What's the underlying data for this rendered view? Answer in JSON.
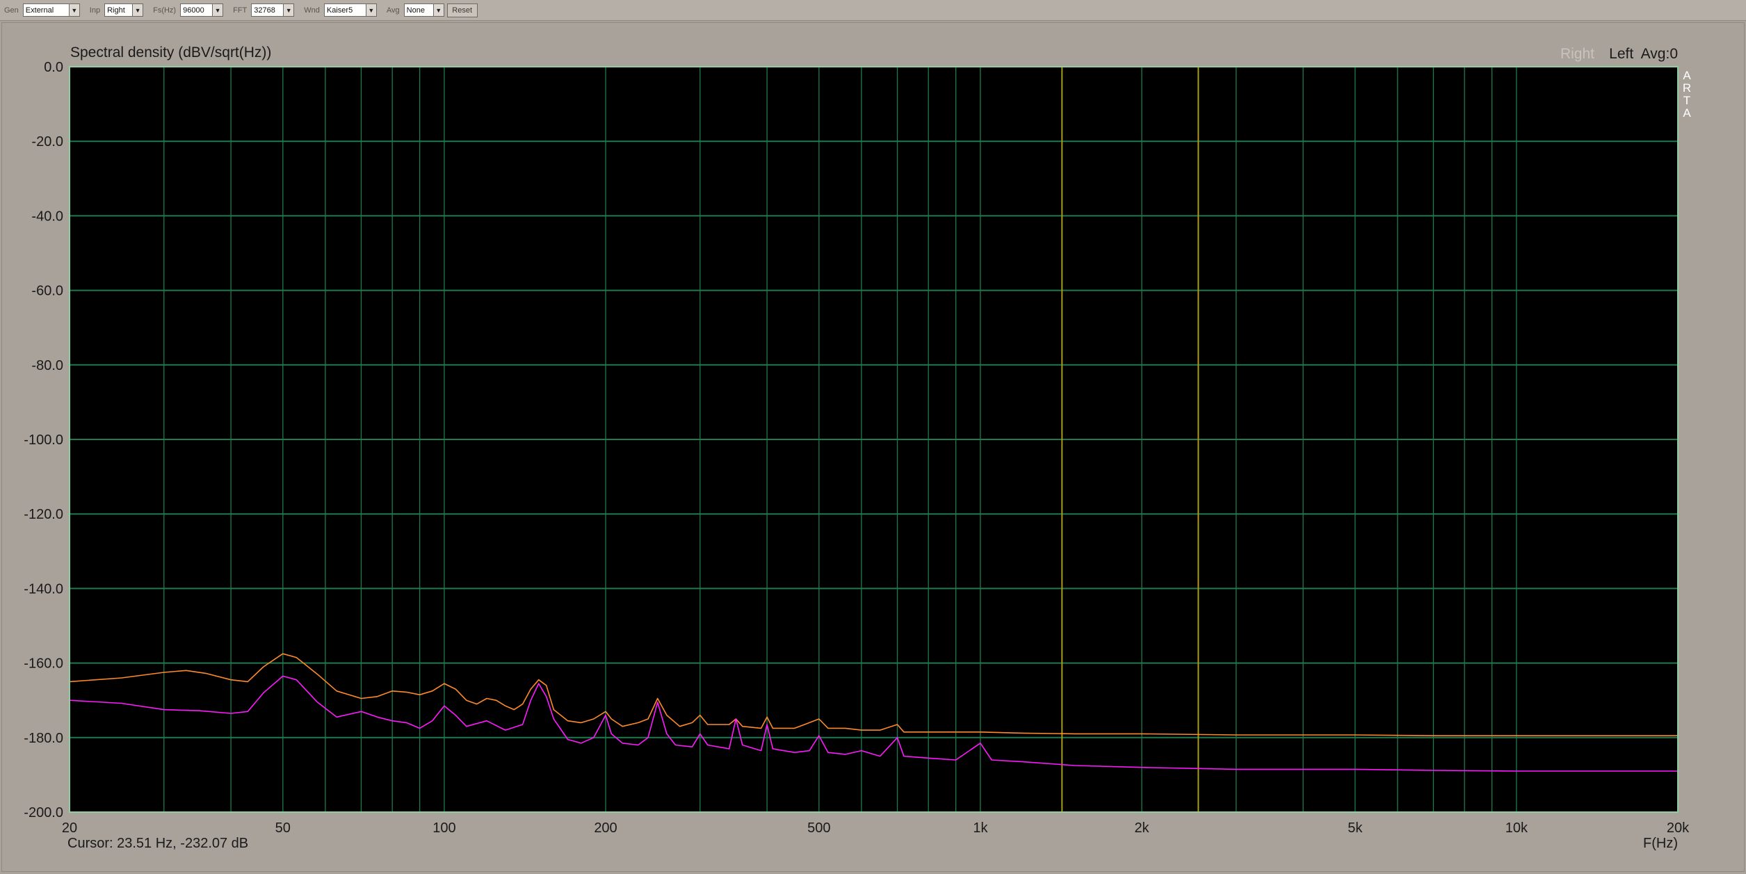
{
  "toolbar": {
    "gen_label": "Gen",
    "gen_value": "External",
    "inp_label": "Inp",
    "inp_value": "Right",
    "fs_label": "Fs(Hz)",
    "fs_value": "96000",
    "fft_label": "FFT",
    "fft_value": "32768",
    "wnd_label": "Wnd",
    "wnd_value": "Kaiser5",
    "avg_label": "Avg",
    "avg_value": "None",
    "reset_label": "Reset"
  },
  "overlay": {
    "channel_ghost": "Right",
    "channel_info": "Left  Avg:0",
    "cursor_text": "Cursor: 23.51 Hz, -232.07 dB",
    "watermark_letters": [
      "A",
      "R",
      "T",
      "A"
    ]
  },
  "colors": {
    "plot_background": "#000000",
    "grid": "#1f7a4d",
    "plot_border": "#8ccf9c",
    "series_left": "#ff8a2a",
    "series_right": "#ff19ff",
    "markers": "#a89a1e"
  },
  "chart_data": {
    "type": "line",
    "title": "Spectral density (dBV/sqrt(Hz))",
    "xlabel": "F(Hz)",
    "ylabel": "",
    "x_scale": "log",
    "xlim": [
      20,
      20000
    ],
    "ylim": [
      -200,
      0
    ],
    "x_ticks": [
      {
        "value": 20,
        "label": "20"
      },
      {
        "value": 50,
        "label": "50"
      },
      {
        "value": 100,
        "label": "100"
      },
      {
        "value": 200,
        "label": "200"
      },
      {
        "value": 500,
        "label": "500"
      },
      {
        "value": 1000,
        "label": "1k"
      },
      {
        "value": 2000,
        "label": "2k"
      },
      {
        "value": 5000,
        "label": "5k"
      },
      {
        "value": 10000,
        "label": "10k"
      },
      {
        "value": 20000,
        "label": "20k"
      }
    ],
    "y_ticks": [
      {
        "value": 0,
        "label": "0.0"
      },
      {
        "value": -20,
        "label": "-20.0"
      },
      {
        "value": -40,
        "label": "-40.0"
      },
      {
        "value": -60,
        "label": "-60.0"
      },
      {
        "value": -80,
        "label": "-80.0"
      },
      {
        "value": -100,
        "label": "-100.0"
      },
      {
        "value": -120,
        "label": "-120.0"
      },
      {
        "value": -140,
        "label": "-140.0"
      },
      {
        "value": -160,
        "label": "-160.0"
      },
      {
        "value": -180,
        "label": "-180.0"
      },
      {
        "value": -200,
        "label": "-200.0"
      }
    ],
    "grid": true,
    "marker_lines_hz": [
      1420,
      2550
    ],
    "series": [
      {
        "color": "#ff8a2a",
        "points": [
          [
            20,
            -165
          ],
          [
            25,
            -164
          ],
          [
            30,
            -162.5
          ],
          [
            33,
            -162
          ],
          [
            36,
            -162.8
          ],
          [
            40,
            -164.5
          ],
          [
            43,
            -165
          ],
          [
            46,
            -161
          ],
          [
            50,
            -157.5
          ],
          [
            53,
            -158.5
          ],
          [
            58,
            -163
          ],
          [
            63,
            -167.5
          ],
          [
            70,
            -169.5
          ],
          [
            75,
            -169
          ],
          [
            80,
            -167.5
          ],
          [
            85,
            -167.8
          ],
          [
            90,
            -168.5
          ],
          [
            95,
            -167.5
          ],
          [
            100,
            -165.5
          ],
          [
            105,
            -167
          ],
          [
            110,
            -170
          ],
          [
            115,
            -171
          ],
          [
            120,
            -169.5
          ],
          [
            125,
            -170
          ],
          [
            130,
            -171.5
          ],
          [
            135,
            -172.5
          ],
          [
            140,
            -171
          ],
          [
            145,
            -167
          ],
          [
            150,
            -164.5
          ],
          [
            155,
            -166
          ],
          [
            160,
            -172.5
          ],
          [
            170,
            -175.5
          ],
          [
            180,
            -176
          ],
          [
            190,
            -175
          ],
          [
            200,
            -173
          ],
          [
            205,
            -175
          ],
          [
            215,
            -177
          ],
          [
            230,
            -176
          ],
          [
            240,
            -175
          ],
          [
            250,
            -169.5
          ],
          [
            260,
            -174
          ],
          [
            275,
            -177
          ],
          [
            290,
            -176
          ],
          [
            300,
            -174
          ],
          [
            310,
            -176.5
          ],
          [
            340,
            -176.5
          ],
          [
            350,
            -175
          ],
          [
            360,
            -177
          ],
          [
            390,
            -177.5
          ],
          [
            400,
            -174.5
          ],
          [
            410,
            -177.5
          ],
          [
            450,
            -177.5
          ],
          [
            470,
            -176.5
          ],
          [
            500,
            -175
          ],
          [
            520,
            -177.5
          ],
          [
            560,
            -177.5
          ],
          [
            600,
            -178
          ],
          [
            650,
            -178
          ],
          [
            700,
            -176.5
          ],
          [
            720,
            -178.5
          ],
          [
            800,
            -178.5
          ],
          [
            900,
            -178.5
          ],
          [
            1000,
            -178.5
          ],
          [
            1200,
            -178.8
          ],
          [
            1500,
            -179
          ],
          [
            2000,
            -179
          ],
          [
            3000,
            -179.3
          ],
          [
            5000,
            -179.3
          ],
          [
            7000,
            -179.5
          ],
          [
            10000,
            -179.5
          ],
          [
            15000,
            -179.5
          ],
          [
            20000,
            -179.5
          ]
        ]
      },
      {
        "color": "#ff19ff",
        "points": [
          [
            20,
            -170
          ],
          [
            25,
            -170.8
          ],
          [
            30,
            -172.5
          ],
          [
            35,
            -172.8
          ],
          [
            40,
            -173.5
          ],
          [
            43,
            -173
          ],
          [
            46,
            -168
          ],
          [
            50,
            -163.5
          ],
          [
            53,
            -164.5
          ],
          [
            58,
            -170.5
          ],
          [
            63,
            -174.5
          ],
          [
            70,
            -173
          ],
          [
            75,
            -174.5
          ],
          [
            80,
            -175.5
          ],
          [
            85,
            -176
          ],
          [
            90,
            -177.5
          ],
          [
            95,
            -175.5
          ],
          [
            100,
            -171.5
          ],
          [
            105,
            -174
          ],
          [
            110,
            -177
          ],
          [
            120,
            -175.5
          ],
          [
            130,
            -178
          ],
          [
            140,
            -176.5
          ],
          [
            145,
            -170
          ],
          [
            150,
            -165.5
          ],
          [
            155,
            -169
          ],
          [
            160,
            -175
          ],
          [
            170,
            -180.5
          ],
          [
            180,
            -181.5
          ],
          [
            190,
            -180
          ],
          [
            200,
            -174
          ],
          [
            205,
            -179
          ],
          [
            215,
            -181.5
          ],
          [
            230,
            -182
          ],
          [
            240,
            -180
          ],
          [
            250,
            -170.5
          ],
          [
            260,
            -179
          ],
          [
            270,
            -182
          ],
          [
            290,
            -182.5
          ],
          [
            300,
            -179
          ],
          [
            310,
            -182
          ],
          [
            340,
            -183
          ],
          [
            350,
            -175
          ],
          [
            360,
            -182
          ],
          [
            390,
            -183.5
          ],
          [
            400,
            -176.5
          ],
          [
            410,
            -183
          ],
          [
            450,
            -184
          ],
          [
            480,
            -183.5
          ],
          [
            500,
            -179.5
          ],
          [
            520,
            -184
          ],
          [
            560,
            -184.5
          ],
          [
            600,
            -183.5
          ],
          [
            650,
            -185
          ],
          [
            700,
            -180
          ],
          [
            720,
            -185
          ],
          [
            800,
            -185.5
          ],
          [
            900,
            -186
          ],
          [
            1000,
            -181.5
          ],
          [
            1050,
            -186
          ],
          [
            1200,
            -186.5
          ],
          [
            1500,
            -187.5
          ],
          [
            2000,
            -188
          ],
          [
            3000,
            -188.5
          ],
          [
            5000,
            -188.5
          ],
          [
            7000,
            -188.8
          ],
          [
            10000,
            -189
          ],
          [
            15000,
            -189
          ],
          [
            20000,
            -189
          ]
        ]
      }
    ]
  }
}
